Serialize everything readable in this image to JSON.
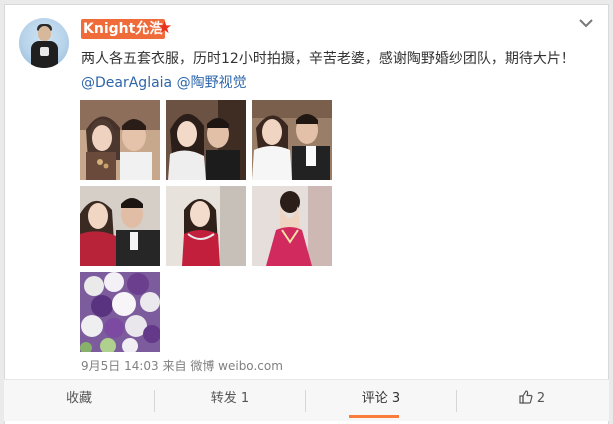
{
  "post": {
    "username": "Knight允浩",
    "vip_badge": "★",
    "text_main": "两人各五套衣服，历时12小时拍摄，辛苦老婆，感谢陶野婚纱团队，期待大片！",
    "mention_1": "@DearAglaia",
    "mention_2": "@陶野视觉",
    "timestamp": "9月5日 14:03",
    "source_prefix": "来自",
    "source_name": "微博 weibo.com"
  },
  "actions": {
    "favorite": "收藏",
    "repost": "转发 1",
    "comment": "评论 3",
    "like_count": "2"
  },
  "colors": {
    "username_bg": "#f06b3a",
    "mention": "#2e66aa",
    "active_tab": "#fa7d3c"
  }
}
